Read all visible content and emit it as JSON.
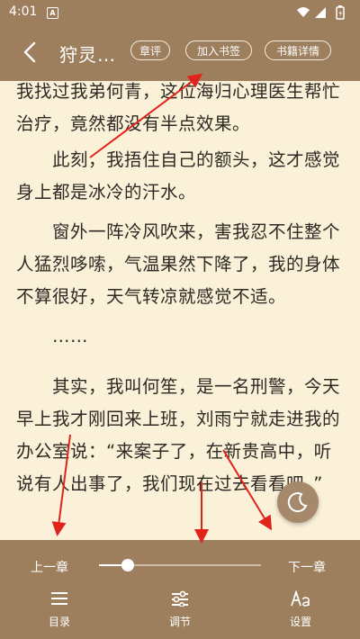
{
  "status": {
    "time": "4:01",
    "notification_letter": "A"
  },
  "header": {
    "book_title": "狩灵…",
    "buttons": {
      "review": "章评",
      "bookmark": "加入书签",
      "details": "书籍详情"
    }
  },
  "content": {
    "paragraphs": [
      "我找过我弟何青，这位海归心理医生帮忙治疗，竟然都没有半点效果。",
      "　　此刻，我捂住自己的额头，这才感觉身上都是冰冷的汗水。",
      "　　窗外一阵冷风吹来，害我忍不住整个人猛烈哆嗦，气温果然下降了，我的身体不算很好，天气转凉就感觉不适。",
      "　　……",
      "　　其实，我叫何笙，是一名刑警，今天早上我才刚回来上班，刘雨宁就走进我的办公室说：“来案子了，在新贵高中，听说有人出事了，我们现在过去看看吧。”"
    ]
  },
  "bottom": {
    "prev_chapter": "上一章",
    "next_chapter": "下一章",
    "progress": 0.18,
    "tools": {
      "catalog": "目录",
      "adjust": "调节",
      "settings": "设置"
    }
  },
  "colors": {
    "bar": "#9d7f5e",
    "page": "#fbf0d8",
    "text": "#2d2a24",
    "arrow": "#e0231b"
  }
}
